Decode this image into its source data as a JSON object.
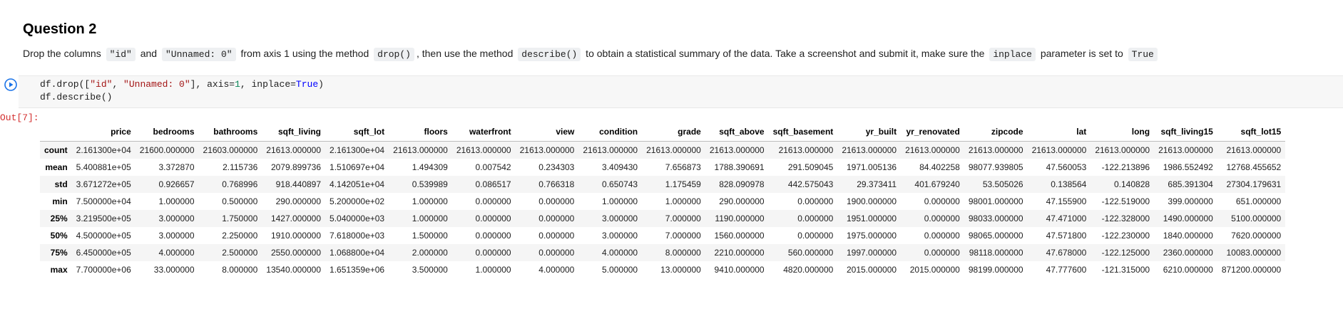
{
  "question": {
    "title": "Question 2",
    "text_part1": "Drop the columns ",
    "code_id": "\"id\"",
    "text_part2": " and ",
    "code_unnamed": "\"Unnamed: 0\"",
    "text_part3": " from axis 1 using the method ",
    "code_drop": "drop()",
    "text_part4": ", then use the method ",
    "code_describe": "describe()",
    "text_part5": " to obtain a statistical summary of the data. Take a screenshot and submit it, make sure the ",
    "code_inplace": "inplace",
    "text_part6": " parameter is set to ",
    "code_true": "True"
  },
  "code_cell": {
    "line1_a": "df.drop([",
    "line1_s1": "\"id\"",
    "line1_b": ", ",
    "line1_s2": "\"Unnamed: 0\"",
    "line1_c": "], axis=",
    "line1_n": "1",
    "line1_d": ", inplace=",
    "line1_kw": "True",
    "line1_e": ")",
    "line2": "df.describe()",
    "run_icon": "play-circle-icon"
  },
  "output": {
    "prompt": "Out[7]:",
    "columns": [
      "",
      "price",
      "bedrooms",
      "bathrooms",
      "sqft_living",
      "sqft_lot",
      "floors",
      "waterfront",
      "view",
      "condition",
      "grade",
      "sqft_above",
      "sqft_basement",
      "yr_built",
      "yr_renovated",
      "zipcode",
      "lat",
      "long",
      "sqft_living15",
      "sqft_lot15"
    ],
    "rows": [
      [
        "count",
        "2.161300e+04",
        "21600.000000",
        "21603.000000",
        "21613.000000",
        "2.161300e+04",
        "21613.000000",
        "21613.000000",
        "21613.000000",
        "21613.000000",
        "21613.000000",
        "21613.000000",
        "21613.000000",
        "21613.000000",
        "21613.000000",
        "21613.000000",
        "21613.000000",
        "21613.000000",
        "21613.000000",
        "21613.000000"
      ],
      [
        "mean",
        "5.400881e+05",
        "3.372870",
        "2.115736",
        "2079.899736",
        "1.510697e+04",
        "1.494309",
        "0.007542",
        "0.234303",
        "3.409430",
        "7.656873",
        "1788.390691",
        "291.509045",
        "1971.005136",
        "84.402258",
        "98077.939805",
        "47.560053",
        "-122.213896",
        "1986.552492",
        "12768.455652"
      ],
      [
        "std",
        "3.671272e+05",
        "0.926657",
        "0.768996",
        "918.440897",
        "4.142051e+04",
        "0.539989",
        "0.086517",
        "0.766318",
        "0.650743",
        "1.175459",
        "828.090978",
        "442.575043",
        "29.373411",
        "401.679240",
        "53.505026",
        "0.138564",
        "0.140828",
        "685.391304",
        "27304.179631"
      ],
      [
        "min",
        "7.500000e+04",
        "1.000000",
        "0.500000",
        "290.000000",
        "5.200000e+02",
        "1.000000",
        "0.000000",
        "0.000000",
        "1.000000",
        "1.000000",
        "290.000000",
        "0.000000",
        "1900.000000",
        "0.000000",
        "98001.000000",
        "47.155900",
        "-122.519000",
        "399.000000",
        "651.000000"
      ],
      [
        "25%",
        "3.219500e+05",
        "3.000000",
        "1.750000",
        "1427.000000",
        "5.040000e+03",
        "1.000000",
        "0.000000",
        "0.000000",
        "3.000000",
        "7.000000",
        "1190.000000",
        "0.000000",
        "1951.000000",
        "0.000000",
        "98033.000000",
        "47.471000",
        "-122.328000",
        "1490.000000",
        "5100.000000"
      ],
      [
        "50%",
        "4.500000e+05",
        "3.000000",
        "2.250000",
        "1910.000000",
        "7.618000e+03",
        "1.500000",
        "0.000000",
        "0.000000",
        "3.000000",
        "7.000000",
        "1560.000000",
        "0.000000",
        "1975.000000",
        "0.000000",
        "98065.000000",
        "47.571800",
        "-122.230000",
        "1840.000000",
        "7620.000000"
      ],
      [
        "75%",
        "6.450000e+05",
        "4.000000",
        "2.500000",
        "2550.000000",
        "1.068800e+04",
        "2.000000",
        "0.000000",
        "0.000000",
        "4.000000",
        "8.000000",
        "2210.000000",
        "560.000000",
        "1997.000000",
        "0.000000",
        "98118.000000",
        "47.678000",
        "-122.125000",
        "2360.000000",
        "10083.000000"
      ],
      [
        "max",
        "7.700000e+06",
        "33.000000",
        "8.000000",
        "13540.000000",
        "1.651359e+06",
        "3.500000",
        "1.000000",
        "4.000000",
        "5.000000",
        "13.000000",
        "9410.000000",
        "4820.000000",
        "2015.000000",
        "2015.000000",
        "98199.000000",
        "47.777600",
        "-121.315000",
        "6210.000000",
        "871200.000000"
      ]
    ]
  },
  "colors": {
    "run_icon": "#1a73e8",
    "prompt": "#d32f2f",
    "row_stripe": "#f5f5f5"
  }
}
